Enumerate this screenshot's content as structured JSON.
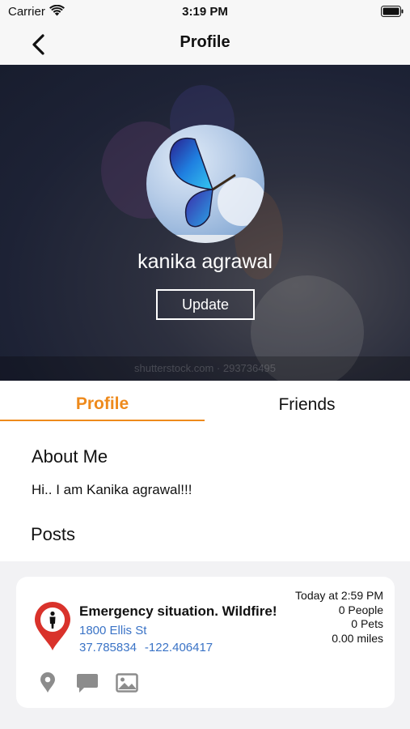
{
  "status_bar": {
    "carrier": "Carrier",
    "time": "3:19 PM"
  },
  "nav": {
    "title": "Profile",
    "back_icon": "chevron-left-icon"
  },
  "profile": {
    "name": "kanika agrawal",
    "update_label": "Update",
    "cover_watermark": "shutterstock.com · 293736495"
  },
  "tabs": [
    {
      "label": "Profile",
      "active": true
    },
    {
      "label": "Friends",
      "active": false
    }
  ],
  "about": {
    "title": "About Me",
    "text": "Hi.. I am Kanika agrawal!!!"
  },
  "posts": {
    "title": "Posts",
    "items": [
      {
        "title": "Emergency situation. Wildfire!",
        "address": "1800 Ellis St",
        "latitude": "37.785834",
        "longitude": "-122.406417",
        "time": "Today at 2:59 PM",
        "people": "0  People",
        "pets": "0  Pets",
        "distance": "0.00 miles"
      }
    ]
  },
  "colors": {
    "accent": "#ee8a1c",
    "link": "#3a73c6",
    "pin_red": "#d9322b",
    "icon_gray": "#8c8c8c"
  }
}
